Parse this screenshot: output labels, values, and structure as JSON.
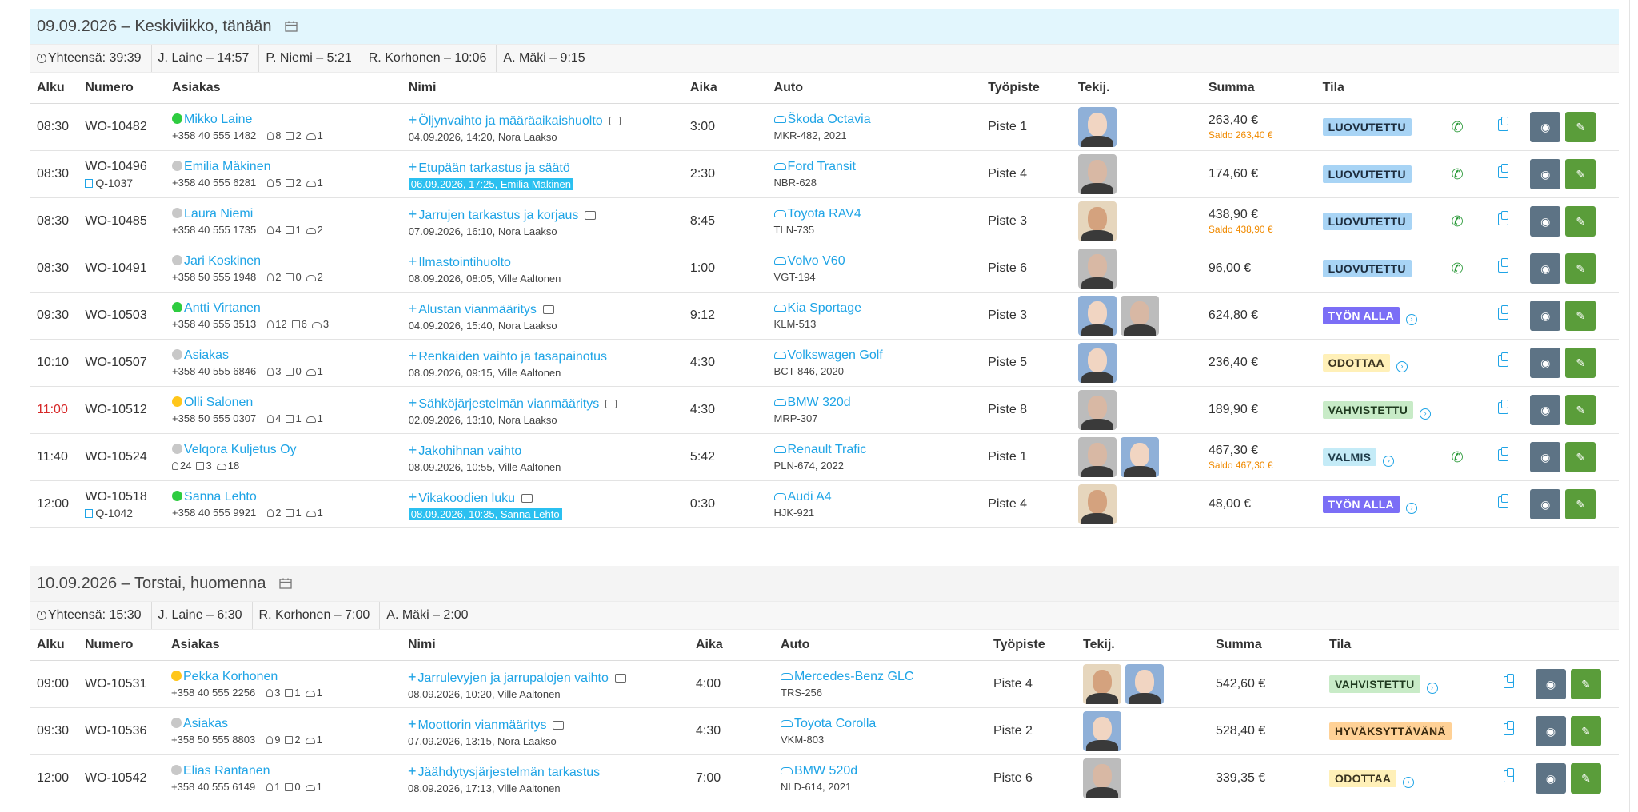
{
  "columns": [
    "Alku",
    "Numero",
    "Asiakas",
    "Nimi",
    "Aika",
    "Auto",
    "Työpiste",
    "Tekij.",
    "Summa",
    "Tila"
  ],
  "days": [
    {
      "title": "09.09.2026 – Keskiviikko, tänään",
      "summary": [
        "Yhteensä: 39:39",
        "J. Laine – 14:57",
        "P. Niemi – 5:21",
        "R. Korhonen – 10:06",
        "A. Mäki – 9:15"
      ],
      "rows": [
        {
          "time": "08:30",
          "time_red": false,
          "number": "WO-10482",
          "quote": "",
          "dot": "green",
          "customer": "Mikko Laine",
          "phone": "+358 40 555 1482",
          "keys": "8",
          "docs": "2",
          "cars": "1",
          "name": "Öljynvaihto ja määräaikaishuolto",
          "comment": true,
          "meta": "04.09.2026, 14:20, Nora Laakso",
          "meta_hl": false,
          "duration": "3:00",
          "car": "Škoda Octavia",
          "plate": "MKR-482, 2021",
          "station": "Piste 1",
          "avatars": [
            "blue"
          ],
          "amount": "263,40 €",
          "saldo": "Saldo 263,40 €",
          "status": "LUOVUTETTU",
          "status_class": "b-luov",
          "arrow": false,
          "phone_icon": true
        },
        {
          "time": "08:30",
          "time_red": false,
          "number": "WO-10496",
          "quote": "Q-1037",
          "dot": "grey",
          "customer": "Emilia Mäkinen",
          "phone": "+358 40 555 6281",
          "keys": "5",
          "docs": "2",
          "cars": "1",
          "name": "Etupään tarkastus ja säätö",
          "comment": false,
          "meta": "06.09.2026, 17:25, Emilia Mäkinen",
          "meta_hl": true,
          "duration": "2:30",
          "car": "Ford Transit",
          "plate": "NBR-628",
          "station": "Piste 4",
          "avatars": [
            "grey"
          ],
          "amount": "174,60 €",
          "saldo": "",
          "status": "LUOVUTETTU",
          "status_class": "b-luov",
          "arrow": false,
          "phone_icon": true
        },
        {
          "time": "08:30",
          "time_red": false,
          "number": "WO-10485",
          "quote": "",
          "dot": "grey",
          "customer": "Laura Niemi",
          "phone": "+358 40 555 1735",
          "keys": "4",
          "docs": "1",
          "cars": "2",
          "name": "Jarrujen tarkastus ja korjaus",
          "comment": true,
          "meta": "07.09.2026, 16:10, Nora Laakso",
          "meta_hl": false,
          "duration": "8:45",
          "car": "Toyota RAV4",
          "plate": "TLN-735",
          "station": "Piste 3",
          "avatars": [
            "beige"
          ],
          "amount": "438,90 €",
          "saldo": "Saldo 438,90 €",
          "status": "LUOVUTETTU",
          "status_class": "b-luov",
          "arrow": false,
          "phone_icon": true
        },
        {
          "time": "08:30",
          "time_red": false,
          "number": "WO-10491",
          "quote": "",
          "dot": "grey",
          "customer": "Jari Koskinen",
          "phone": "+358 50 555 1948",
          "keys": "2",
          "docs": "0",
          "cars": "2",
          "name": "Ilmastointihuolto",
          "comment": false,
          "meta": "08.09.2026, 08:05, Ville Aaltonen",
          "meta_hl": false,
          "duration": "1:00",
          "car": "Volvo V60",
          "plate": "VGT-194",
          "station": "Piste 6",
          "avatars": [
            "grey"
          ],
          "amount": "96,00 €",
          "saldo": "",
          "status": "LUOVUTETTU",
          "status_class": "b-luov",
          "arrow": false,
          "phone_icon": true
        },
        {
          "time": "09:30",
          "time_red": false,
          "number": "WO-10503",
          "quote": "",
          "dot": "green",
          "customer": "Antti Virtanen",
          "phone": "+358 40 555 3513",
          "keys": "12",
          "docs": "6",
          "cars": "3",
          "name": "Alustan vianmääritys",
          "comment": true,
          "meta": "04.09.2026, 15:40, Nora Laakso",
          "meta_hl": false,
          "duration": "9:12",
          "car": "Kia Sportage",
          "plate": "KLM-513",
          "station": "Piste 3",
          "avatars": [
            "blue",
            "grey"
          ],
          "amount": "624,80 €",
          "saldo": "",
          "status": "TYÖN ALLA",
          "status_class": "b-tyo",
          "arrow": true,
          "phone_icon": false
        },
        {
          "time": "10:10",
          "time_red": false,
          "number": "WO-10507",
          "quote": "",
          "dot": "grey",
          "customer": "Asiakas",
          "phone": "+358 40 555 6846",
          "keys": "3",
          "docs": "0",
          "cars": "1",
          "name": "Renkaiden vaihto ja tasapainotus",
          "comment": false,
          "meta": "08.09.2026, 09:15, Ville Aaltonen",
          "meta_hl": false,
          "duration": "4:30",
          "car": "Volkswagen Golf",
          "plate": "BCT-846, 2020",
          "station": "Piste 5",
          "avatars": [
            "blue"
          ],
          "amount": "236,40 €",
          "saldo": "",
          "status": "ODOTTAA",
          "status_class": "b-odo",
          "arrow": true,
          "phone_icon": false
        },
        {
          "time": "11:00",
          "time_red": true,
          "number": "WO-10512",
          "quote": "",
          "dot": "yellow",
          "customer": "Olli Salonen",
          "phone": "+358 50 555 0307",
          "keys": "4",
          "docs": "1",
          "cars": "1",
          "name": "Sähköjärjestelmän vianmääritys",
          "comment": true,
          "meta": "02.09.2026, 13:10, Nora Laakso",
          "meta_hl": false,
          "duration": "4:30",
          "car": "BMW 320d",
          "plate": "MRP-307",
          "station": "Piste 8",
          "avatars": [
            "grey"
          ],
          "amount": "189,90 €",
          "saldo": "",
          "status": "VAHVISTETTU",
          "status_class": "b-vahv",
          "arrow": true,
          "phone_icon": false
        },
        {
          "time": "11:40",
          "time_red": false,
          "number": "WO-10524",
          "quote": "",
          "dot": "grey",
          "customer": "Velqora Kuljetus Oy",
          "phone": "",
          "keys": "24",
          "docs": "3",
          "cars": "18",
          "name": "Jakohihnan vaihto",
          "comment": false,
          "meta": "08.09.2026, 10:55, Ville Aaltonen",
          "meta_hl": false,
          "duration": "5:42",
          "car": "Renault Trafic",
          "plate": "PLN-674, 2022",
          "station": "Piste 1",
          "avatars": [
            "grey",
            "blue"
          ],
          "amount": "467,30 €",
          "saldo": "Saldo 467,30 €",
          "status": "VALMIS",
          "status_class": "b-valm",
          "arrow": true,
          "phone_icon": true
        },
        {
          "time": "12:00",
          "time_red": false,
          "number": "WO-10518",
          "quote": "Q-1042",
          "dot": "green",
          "customer": "Sanna Lehto",
          "phone": "+358 40 555 9921",
          "keys": "2",
          "docs": "1",
          "cars": "1",
          "name": "Vikakoodien luku",
          "comment": true,
          "meta": "08.09.2026, 10:35, Sanna Lehto",
          "meta_hl": true,
          "duration": "0:30",
          "car": "Audi A4",
          "plate": "HJK-921",
          "station": "Piste 4",
          "avatars": [
            "beige"
          ],
          "amount": "48,00 €",
          "saldo": "",
          "status": "TYÖN ALLA",
          "status_class": "b-tyo",
          "arrow": true,
          "phone_icon": false
        }
      ]
    },
    {
      "title": "10.09.2026 – Torstai, huomenna",
      "summary": [
        "Yhteensä: 15:30",
        "J. Laine – 6:30",
        "R. Korhonen – 7:00",
        "A. Mäki – 2:00"
      ],
      "rows": [
        {
          "time": "09:00",
          "time_red": false,
          "number": "WO-10531",
          "quote": "",
          "dot": "yellow",
          "customer": "Pekka Korhonen",
          "phone": "+358 40 555 2256",
          "keys": "3",
          "docs": "1",
          "cars": "1",
          "name": "Jarrulevyjen ja jarrupalojen vaihto",
          "comment": true,
          "meta": "08.09.2026, 10:20, Ville Aaltonen",
          "meta_hl": false,
          "duration": "4:00",
          "car": "Mercedes-Benz GLC",
          "plate": "TRS-256",
          "station": "Piste 4",
          "avatars": [
            "beige",
            "blue"
          ],
          "amount": "542,60 €",
          "saldo": "",
          "status": "VAHVISTETTU",
          "status_class": "b-vahv",
          "arrow": true,
          "phone_icon": false
        },
        {
          "time": "09:30",
          "time_red": false,
          "number": "WO-10536",
          "quote": "",
          "dot": "grey",
          "customer": "Asiakas",
          "phone": "+358 50 555 8803",
          "keys": "9",
          "docs": "2",
          "cars": "1",
          "name": "Moottorin vianmääritys",
          "comment": true,
          "meta": "07.09.2026, 13:15, Nora Laakso",
          "meta_hl": false,
          "duration": "4:30",
          "car": "Toyota Corolla",
          "plate": "VKM-803",
          "station": "Piste 2",
          "avatars": [
            "blue"
          ],
          "amount": "528,40 €",
          "saldo": "",
          "status": "HYVÄKSYTTÄVÄNÄ",
          "status_class": "b-hyv",
          "arrow": false,
          "phone_icon": false
        },
        {
          "time": "12:00",
          "time_red": false,
          "number": "WO-10542",
          "quote": "",
          "dot": "grey",
          "customer": "Elias Rantanen",
          "phone": "+358 40 555 6149",
          "keys": "1",
          "docs": "0",
          "cars": "1",
          "name": "Jäähdytysjärjestelmän tarkastus",
          "comment": false,
          "meta": "08.09.2026, 17:13, Ville Aaltonen",
          "meta_hl": false,
          "duration": "7:00",
          "car": "BMW 520d",
          "plate": "NLD-614, 2021",
          "station": "Piste 6",
          "avatars": [
            "grey"
          ],
          "amount": "339,35 €",
          "saldo": "",
          "status": "ODOTTAA",
          "status_class": "b-odo",
          "arrow": true,
          "phone_icon": false
        }
      ]
    }
  ],
  "colors": {
    "link": "#1fa4e6",
    "green_dot": "#2ecc40",
    "grey_dot": "#c8c8c8",
    "yellow_dot": "#ffc61a"
  },
  "icons": {
    "view": "eye-icon",
    "edit": "pencil-icon",
    "copy": "copy-icon",
    "phone": "phone-icon",
    "calendar": "calendar-icon"
  }
}
